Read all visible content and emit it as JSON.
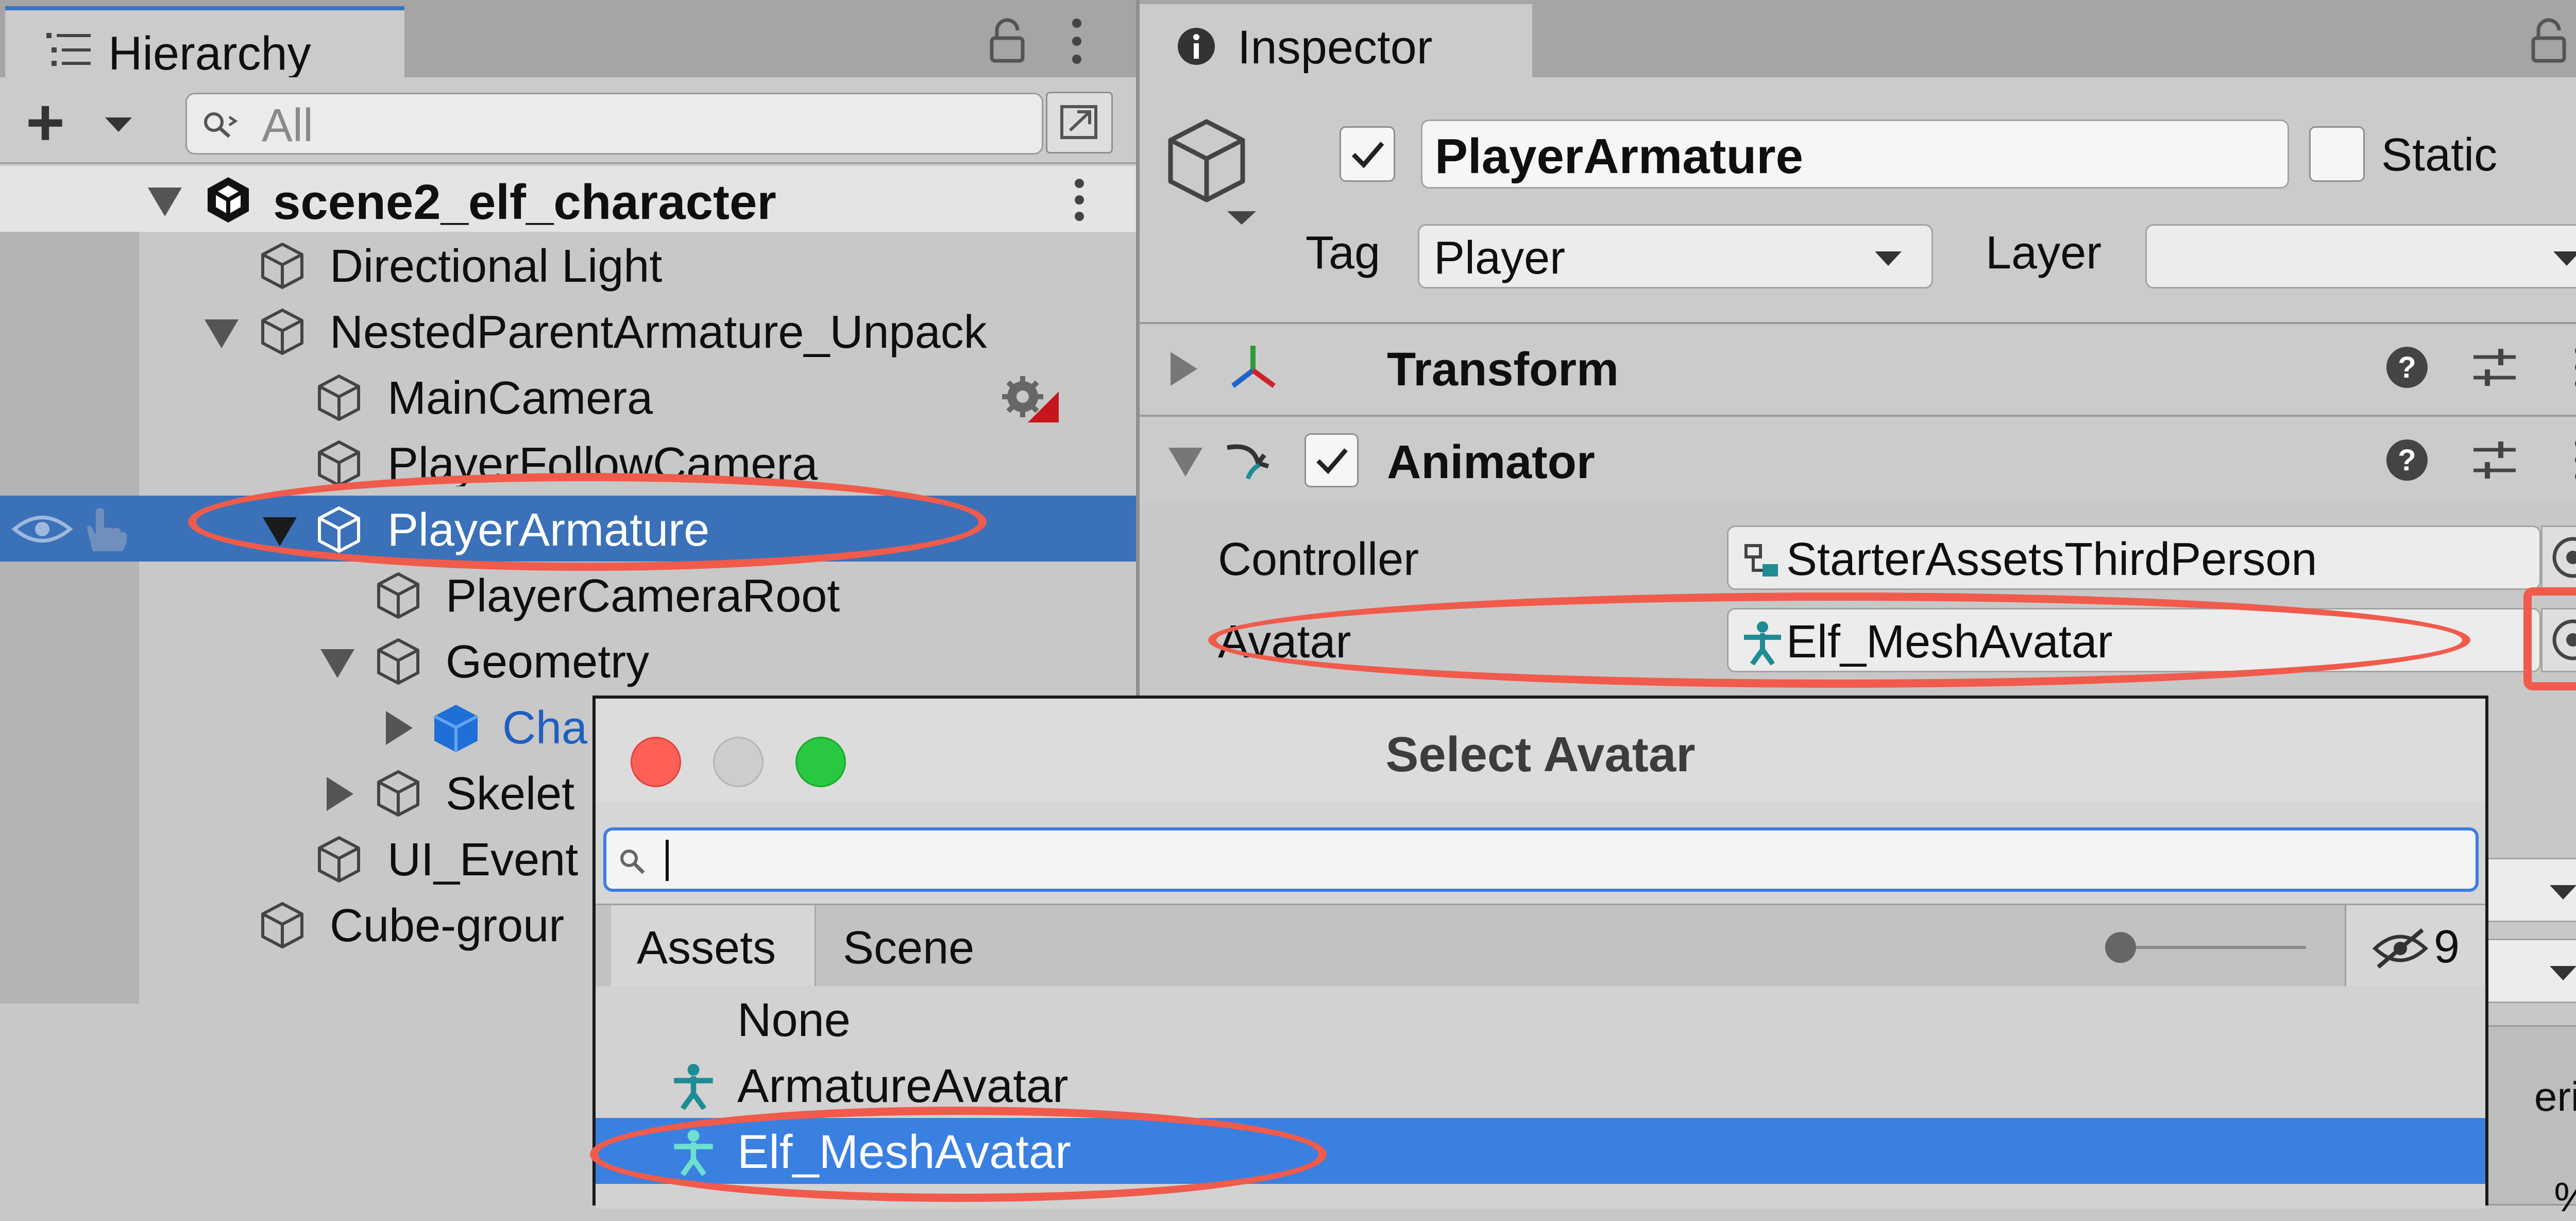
{
  "hierarchy": {
    "tab_label": "Hierarchy",
    "add_label": "+",
    "search_placeholder": "All",
    "scene_name": "scene2_elf_character",
    "items": [
      {
        "label": "Directional Light"
      },
      {
        "label": "NestedParentArmature_Unpack"
      },
      {
        "label": "MainCamera"
      },
      {
        "label": "PlayerFollowCamera"
      },
      {
        "label": "PlayerArmature"
      },
      {
        "label": "PlayerCameraRoot"
      },
      {
        "label": "Geometry"
      },
      {
        "label": "Cha"
      },
      {
        "label": "Skelet"
      },
      {
        "label": "UI_Event"
      },
      {
        "label": "Cube-grour"
      }
    ]
  },
  "inspector": {
    "tab_label": "Inspector",
    "object_name": "PlayerArmature",
    "static_label": "Static",
    "tag_label": "Tag",
    "tag_value": "Player",
    "layer_label": "Layer",
    "layer_value": "",
    "transform_title": "Transform",
    "animator_title": "Animator",
    "controller_label": "Controller",
    "controller_value": "StarterAssetsThirdPerson",
    "avatar_label": "Avatar",
    "avatar_value": "Elf_MeshAvatar",
    "partial_text_1": "eric:",
    "partial_text_2": "%)"
  },
  "picker": {
    "title": "Select Avatar",
    "search_value": "",
    "tabs": [
      "Assets",
      "Scene"
    ],
    "hidden_count": "9",
    "items": [
      {
        "label": "None"
      },
      {
        "label": "ArmatureAvatar"
      },
      {
        "label": "Elf_MeshAvatar"
      }
    ]
  },
  "colors": {
    "selection_blue": "#3b71b9",
    "list_selection_blue": "#3a80e1",
    "annotation_red": "#f05b4c",
    "avatar_icon_teal": "#1e8c94",
    "prefab_blue": "#1f6fd6"
  }
}
